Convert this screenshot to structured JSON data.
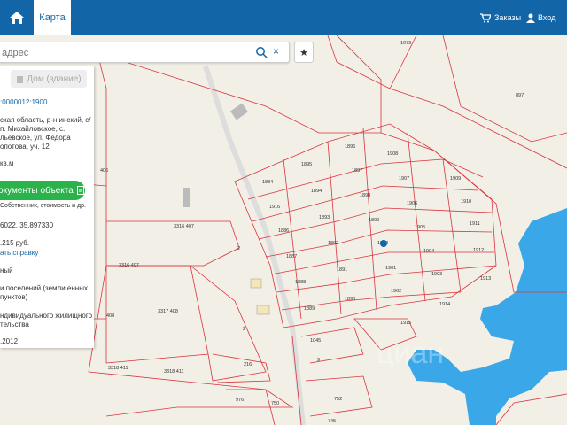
{
  "topbar": {
    "home_icon": "home-icon",
    "tab_map": "Карта",
    "orders_label": "Заказы",
    "login_label": "Вход"
  },
  "search": {
    "placeholder": "адрес",
    "clear": "×",
    "favorite": "★"
  },
  "panel": {
    "building_btn": "Дом (здание)",
    "cadastral_number": ":0000012:1900",
    "address": "ская область, р-н инский, с/п. Михайловское, с. льевское, ул. Федора опотова, уч. 12",
    "area": "кв.м",
    "docs_btn": "Документы объекта",
    "docs_sub": "Собственник, стоимость и др.",
    "coords": "6022, 35.897330",
    "price": ".215 руб.",
    "cert_link": "ать справку",
    "status": "ный",
    "category": "и поселений (земли енных пунктов)",
    "usage": "ндивидуального жилищного тельства",
    "date": ".2012"
  },
  "map": {
    "parcels": [
      "1079",
      "897",
      "406",
      "1896",
      "1895",
      "1908",
      "1897",
      "1884",
      "1894",
      "1907",
      "1909",
      "1898",
      "1906",
      "1910",
      "1916",
      "1893",
      "1899",
      "1905",
      "1911",
      "1886",
      "1892",
      "1900",
      "1904",
      "1912",
      "1887",
      "1891",
      "1901",
      "1903",
      "1913",
      "1888",
      "1890",
      "1902",
      "1914",
      "1889",
      "1915",
      "3316 407",
      "3316 407",
      "2",
      "408",
      "3317 408",
      "2",
      "216",
      "3318 411",
      "3318 411",
      "1045",
      "9",
      "976",
      "750",
      "752",
      "745"
    ],
    "water_color": "#3aa8e8",
    "border_color": "#d9363e",
    "watermark": "циан"
  }
}
